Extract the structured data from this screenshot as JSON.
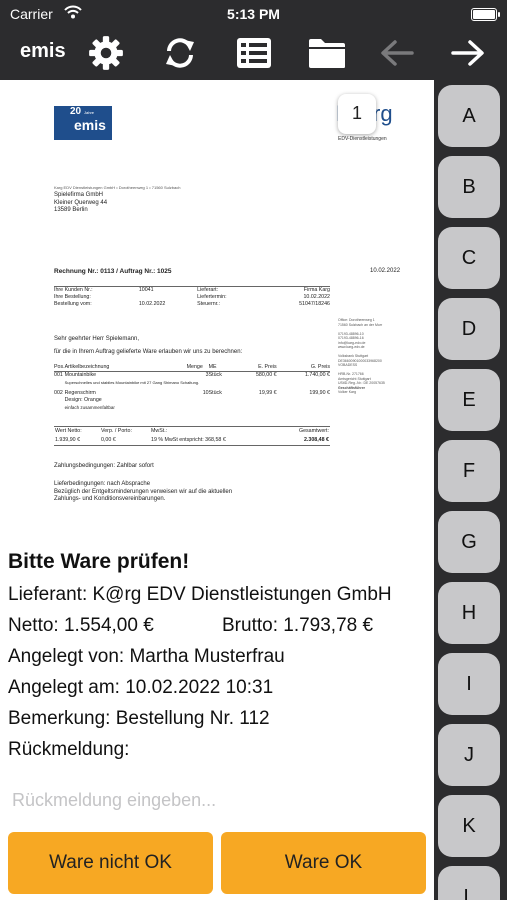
{
  "status_bar": {
    "carrier": "Carrier",
    "time": "5:13 PM"
  },
  "toolbar": {
    "brand": "emis",
    "icons": [
      "gear-icon",
      "refresh-icon",
      "list-icon",
      "folder-icon",
      "arrow-left-icon",
      "arrow-right-icon"
    ]
  },
  "document": {
    "page_number": "1",
    "logo_emis_badge": "20",
    "logo_emis_badge_sub": "Jahre",
    "logo_emis": "emis",
    "logo_karg": "K@rg",
    "logo_karg_sub": "EDV-Dienstleistungen",
    "sender_line": "Karg EDV Dienstleistungen GmbH • Dorotheenweg 1 • 71560 Sulzbach",
    "recipient": [
      "Spielefirma GmbH",
      "Kleiner Querweg 44",
      "13589 Berlin"
    ],
    "title": "Rechnung Nr.: 0113 / Auftrag Nr.: 1025",
    "date": "10.02.2022",
    "meta": [
      [
        "Ihre Kunden Nr.:",
        "10041",
        "Lieferart:",
        "Firma Karg"
      ],
      [
        "Ihre Bestellung:",
        "",
        "Liefertermin:",
        "10.02.2022"
      ],
      [
        "Bestellung vom:",
        "10.02.2022",
        "Steuernr.:",
        "51047/18246"
      ]
    ],
    "greeting": "Sehr geehrter Herr Spielemann,",
    "intro": "für die in Ihrem Auftrag gelieferte Ware erlauben wir uns zu berechnen:",
    "pos_header": [
      "Pos.",
      "Artikelbezeichnung",
      "Menge",
      "ME",
      "E. Preis",
      "G. Preis"
    ],
    "positions": [
      {
        "pos": "001",
        "name": "Mountainbike",
        "menge": "3",
        "me": "Stück",
        "epreis": "580,00 €",
        "gpreis": "1.740,00 €",
        "desc": [
          "Superschnelles und stabiles Mountainbike mit 27 Gang Shimano Schaltung."
        ]
      },
      {
        "pos": "002",
        "name": "Regenschirm",
        "menge": "10",
        "me": "Stück",
        "epreis": "19,99 €",
        "gpreis": "199,90 €",
        "desc": [
          "Design: Orange",
          "einfach zusammenfaltbar"
        ]
      }
    ],
    "sidebar_lines": [
      "Office: Dorotheenweg 1",
      "71560 Sulzbach an der Murr",
      "",
      "07193-48896-10",
      "07193-48896-16",
      "info@karg-edv.de",
      "www.karg-edv.de",
      "",
      "Volksbank Stuttgart",
      "DE36600901000033968200",
      "VOBADESS",
      "",
      "HRB-Nr. 271766",
      "Amtsgericht Stuttgart",
      "UStID-Reg.-Nr.: DE 20057635",
      "Geschäftsführer",
      "Volker Karg"
    ],
    "totals_header": [
      "Wert Netto:",
      "Verp. / Porto:",
      "MwSt.:",
      "Gesamtwert:"
    ],
    "totals_values": [
      "1.939,90 €",
      "0,00 €",
      "19 % MwSt entspricht: 368,58 €",
      "2.308,48 €"
    ],
    "payment": "Zahlungsbedingungen: Zahlbar sofort",
    "delivery": [
      "Lieferbedingungen: nach Absprache",
      "Bezüglich der Entgeltsminderungen verweisen wir auf die aktuellen",
      "Zahlungs- und Konditionsvereinbarungen."
    ]
  },
  "info": {
    "heading": "Bitte Ware prüfen!",
    "supplier": "Lieferant: K@rg EDV Dienstleistungen GmbH",
    "net": "Netto: 1.554,00 €",
    "gross": "Brutto: 1.793,78 €",
    "created_by": "Angelegt von: Martha Musterfrau",
    "created_at": "Angelegt am: 10.02.2022 10:31",
    "remark": "Bemerkung: Bestellung Nr. 112",
    "feedback_label": "Rückmeldung:",
    "feedback_placeholder": "Rückmeldung eingeben...",
    "feedback_value": ""
  },
  "buttons": {
    "reject": "Ware nicht OK",
    "accept": "Ware OK"
  },
  "alphabet": [
    "A",
    "B",
    "C",
    "D",
    "E",
    "F",
    "G",
    "H",
    "I",
    "J",
    "K",
    "L"
  ],
  "colors": {
    "toolbar_bg": "#2c2c2e",
    "accent": "#f7a823",
    "letter_bg": "#c8c8ca",
    "content_bg": "#ffffff"
  }
}
